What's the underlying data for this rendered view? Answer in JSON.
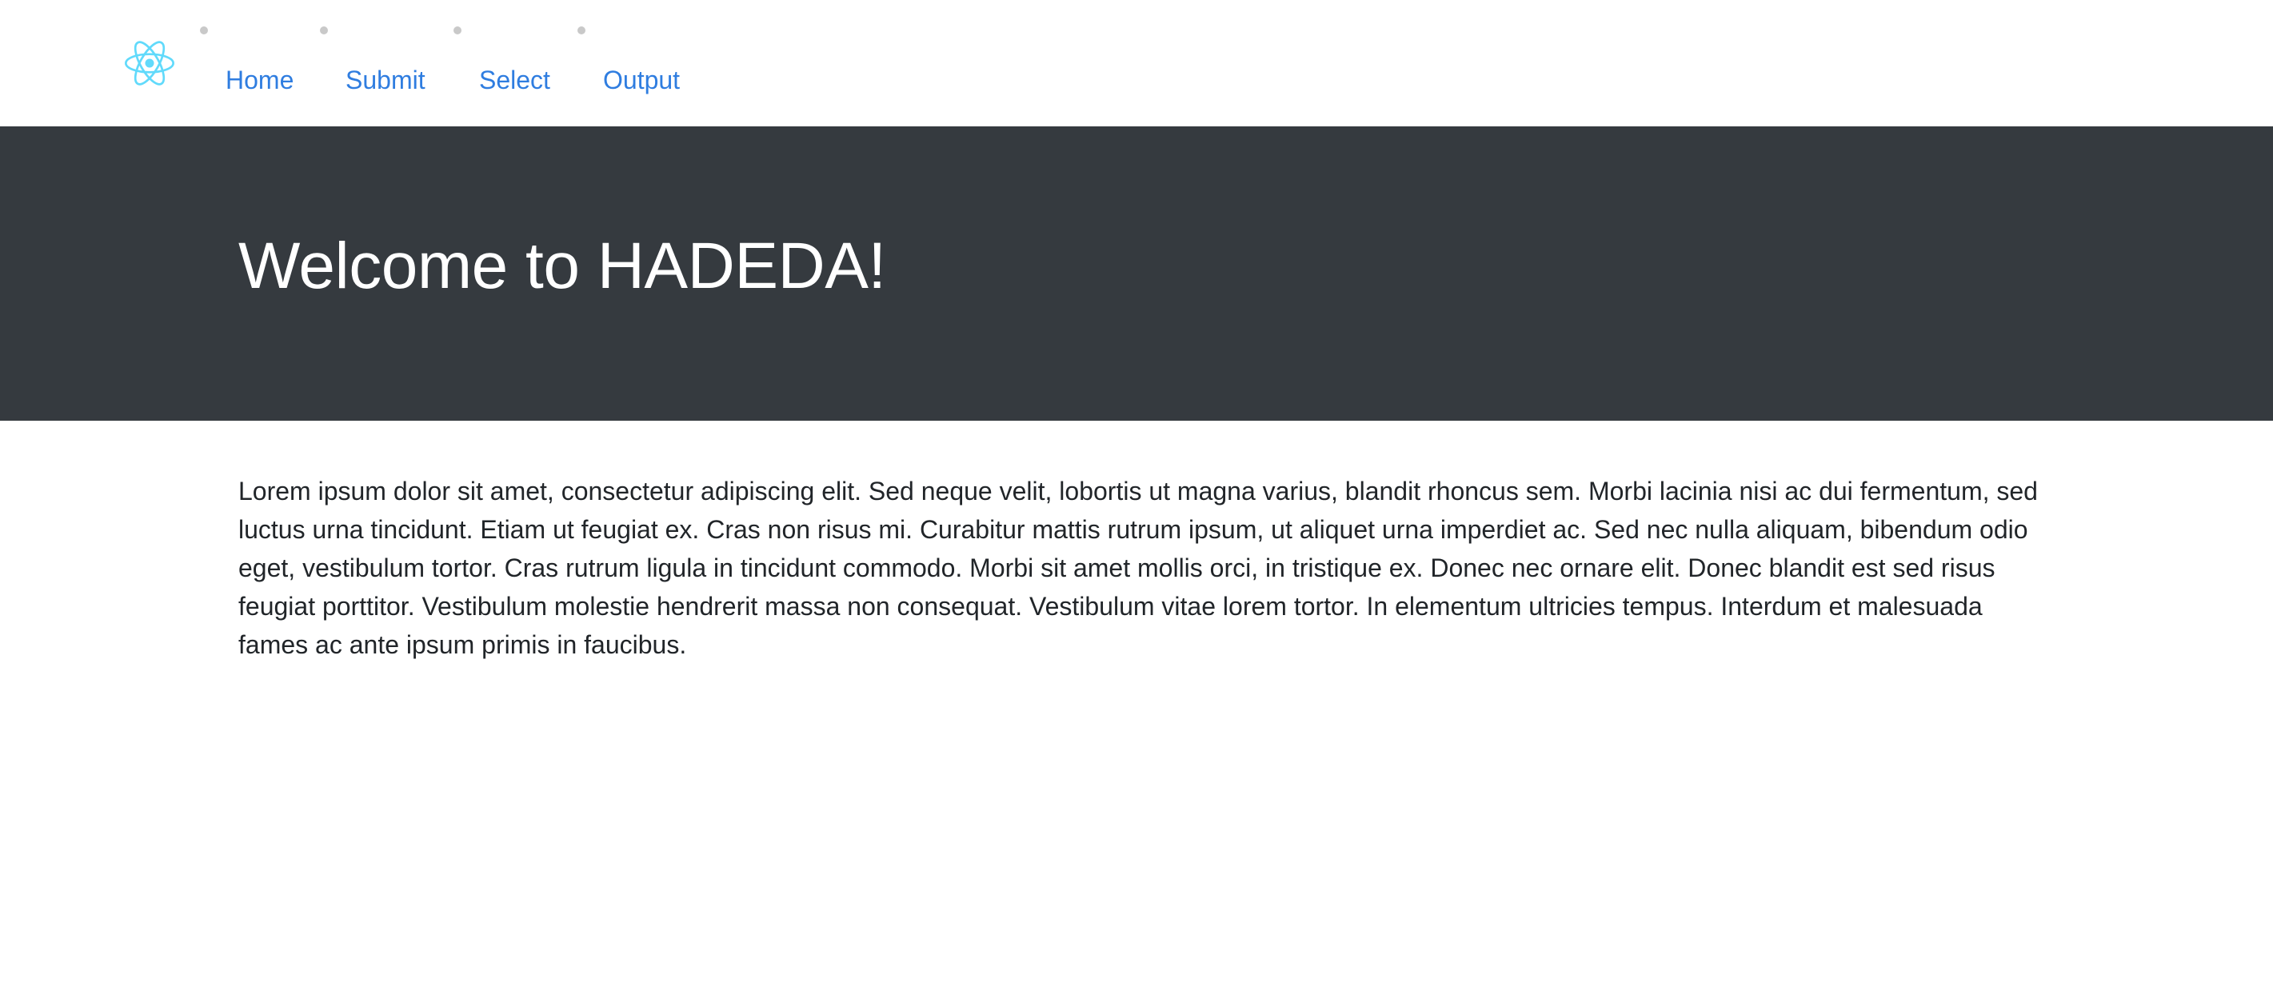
{
  "nav": {
    "logo_icon": "react-atom-icon",
    "logo_color": "#61dafb",
    "items": [
      {
        "label": "Home"
      },
      {
        "label": "Submit"
      },
      {
        "label": "Select"
      },
      {
        "label": "Output"
      }
    ],
    "link_color": "#2f7de0"
  },
  "hero": {
    "title": "Welcome to HADEDA!",
    "background": "#353a3f"
  },
  "main": {
    "paragraph": "Lorem ipsum dolor sit amet, consectetur adipiscing elit. Sed neque velit, lobortis ut magna varius, blandit rhoncus sem. Morbi lacinia nisi ac dui fermentum, sed luctus urna tincidunt. Etiam ut feugiat ex. Cras non risus mi. Curabitur mattis rutrum ipsum, ut aliquet urna imperdiet ac. Sed nec nulla aliquam, bibendum odio eget, vestibulum tortor. Cras rutrum ligula in tincidunt commodo. Morbi sit amet mollis orci, in tristique ex. Donec nec ornare elit. Donec blandit est sed risus feugiat porttitor. Vestibulum molestie hendrerit massa non consequat. Vestibulum vitae lorem tortor. In elementum ultricies tempus. Interdum et malesuada fames ac ante ipsum primis in faucibus."
  }
}
